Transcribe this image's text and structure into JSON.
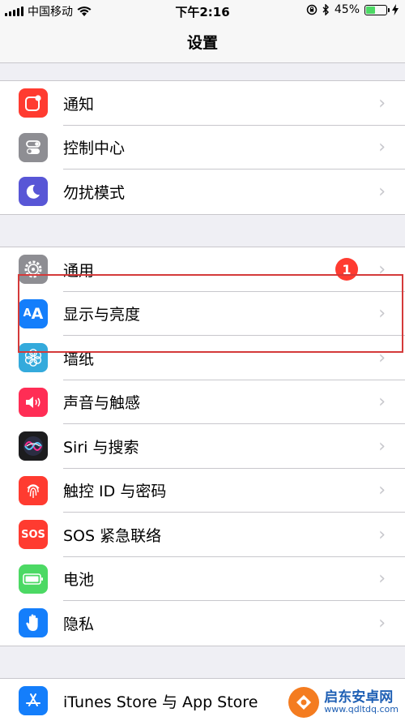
{
  "status_bar": {
    "carrier": "中国移动",
    "time": "下午2:16",
    "battery_percent": "45%",
    "battery_level": 0.45
  },
  "nav": {
    "title": "设置"
  },
  "groups": [
    {
      "items": [
        {
          "label": "通知",
          "icon": "notifications-icon",
          "color": "#ff3b30"
        },
        {
          "label": "控制中心",
          "icon": "control-center-icon",
          "color": "#8e8e93"
        },
        {
          "label": "勿扰模式",
          "icon": "moon-icon",
          "color": "#5856d6"
        }
      ]
    },
    {
      "items": [
        {
          "label": "通用",
          "icon": "gear-icon",
          "color": "#8e8e93",
          "badge": "1"
        },
        {
          "label": "显示与亮度",
          "icon": "display-brightness-icon",
          "color": "#147efb"
        },
        {
          "label": "墙纸",
          "icon": "wallpaper-icon",
          "color": "#34aadc"
        },
        {
          "label": "声音与触感",
          "icon": "speaker-icon",
          "color": "#ff2d55"
        },
        {
          "label": "Siri 与搜索",
          "icon": "siri-icon",
          "color": "#1c1c1e"
        },
        {
          "label": "触控 ID 与密码",
          "icon": "fingerprint-icon",
          "color": "#ff3b30"
        },
        {
          "label": "SOS 紧急联络",
          "icon": "sos-icon",
          "color": "#ff3b30",
          "icon_text": "SOS"
        },
        {
          "label": "电池",
          "icon": "battery-icon",
          "color": "#4cd964"
        },
        {
          "label": "隐私",
          "icon": "hand-icon",
          "color": "#147efb"
        }
      ]
    },
    {
      "items": [
        {
          "label": "iTunes Store 与 App Store",
          "icon": "app-store-icon",
          "color": "#147efb"
        }
      ]
    }
  ],
  "watermark": {
    "title": "启东安卓网",
    "url": "www.qdltdq.com"
  }
}
